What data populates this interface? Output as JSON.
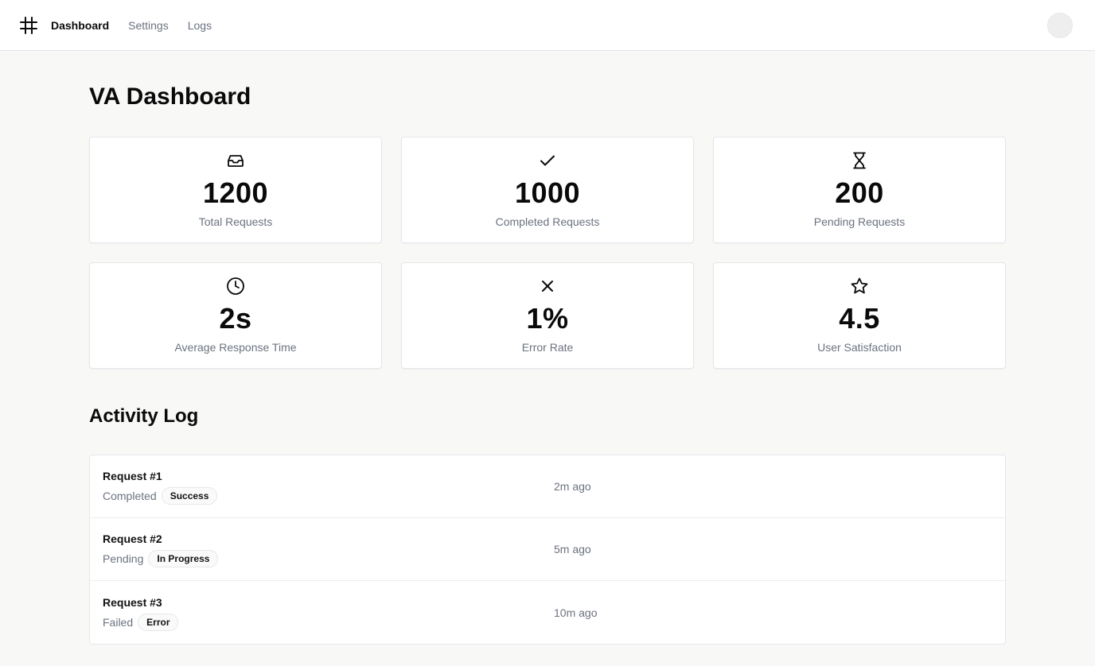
{
  "header": {
    "logo_icon": "hash-icon",
    "nav": [
      {
        "label": "Dashboard",
        "active": true
      },
      {
        "label": "Settings",
        "active": false
      },
      {
        "label": "Logs",
        "active": false
      }
    ]
  },
  "page": {
    "title": "VA Dashboard"
  },
  "stats": [
    {
      "icon": "inbox-icon",
      "value": "1200",
      "label": "Total Requests"
    },
    {
      "icon": "check-icon",
      "value": "1000",
      "label": "Completed Requests"
    },
    {
      "icon": "hourglass-icon",
      "value": "200",
      "label": "Pending Requests"
    },
    {
      "icon": "clock-icon",
      "value": "2s",
      "label": "Average Response Time"
    },
    {
      "icon": "x-icon",
      "value": "1%",
      "label": "Error Rate"
    },
    {
      "icon": "star-icon",
      "value": "4.5",
      "label": "User Satisfaction"
    }
  ],
  "activity": {
    "title": "Activity Log",
    "items": [
      {
        "title": "Request #1",
        "status": "Completed",
        "badge": "Success",
        "time": "2m ago"
      },
      {
        "title": "Request #2",
        "status": "Pending",
        "badge": "In Progress",
        "time": "5m ago"
      },
      {
        "title": "Request #3",
        "status": "Failed",
        "badge": "Error",
        "time": "10m ago"
      }
    ]
  }
}
